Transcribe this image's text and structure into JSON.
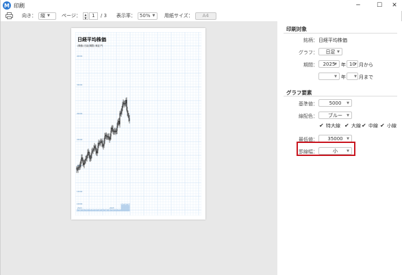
{
  "window": {
    "title": "印刷"
  },
  "toolbar": {
    "orientation_label": "向き：",
    "orientation_value": "縦",
    "page_label": "ページ：",
    "page_current": "1",
    "page_total": "/ 3",
    "zoom_label": "表示率：",
    "zoom_value": "50%",
    "paper_label": "用紙サイズ：",
    "paper_value": "A4"
  },
  "preview": {
    "chart_title": "日経平均株価",
    "chart_subtitle": "(株価) 日足(期間)  東証  円",
    "y_tick_labels": [
      "40000",
      "35000",
      "30000",
      "25000",
      "20000",
      "15000",
      "10000"
    ],
    "x_tick_labels": [
      "2024",
      "2025"
    ]
  },
  "panel": {
    "section_print_target": "印刷対象",
    "stock_label": "銘柄：",
    "stock_value": "日経平均株価",
    "graph_label": "グラフ：",
    "graph_value": "日足",
    "period_label": "期間：",
    "period_year_value": "2025",
    "year_unit": "年",
    "period_month_value": "10",
    "month_unit": "月から",
    "to_year_unit": "年",
    "to_month_unit": "月まで",
    "section_graph_elements": "グラフ要素",
    "base_label": "基準値：",
    "base_value": "5000",
    "line_color_label": "線配色：",
    "line_color_value": "ブルー",
    "checkboxes": [
      "特大線",
      "大線",
      "中線",
      "小線"
    ],
    "min_label": "最低値：",
    "min_value": "35000",
    "grid_width_label": "罫線幅：",
    "grid_width_value": "小"
  },
  "colors": {
    "accent": "#2d7ad2",
    "highlight": "#c8141e",
    "grid": "#cfe3f5"
  }
}
